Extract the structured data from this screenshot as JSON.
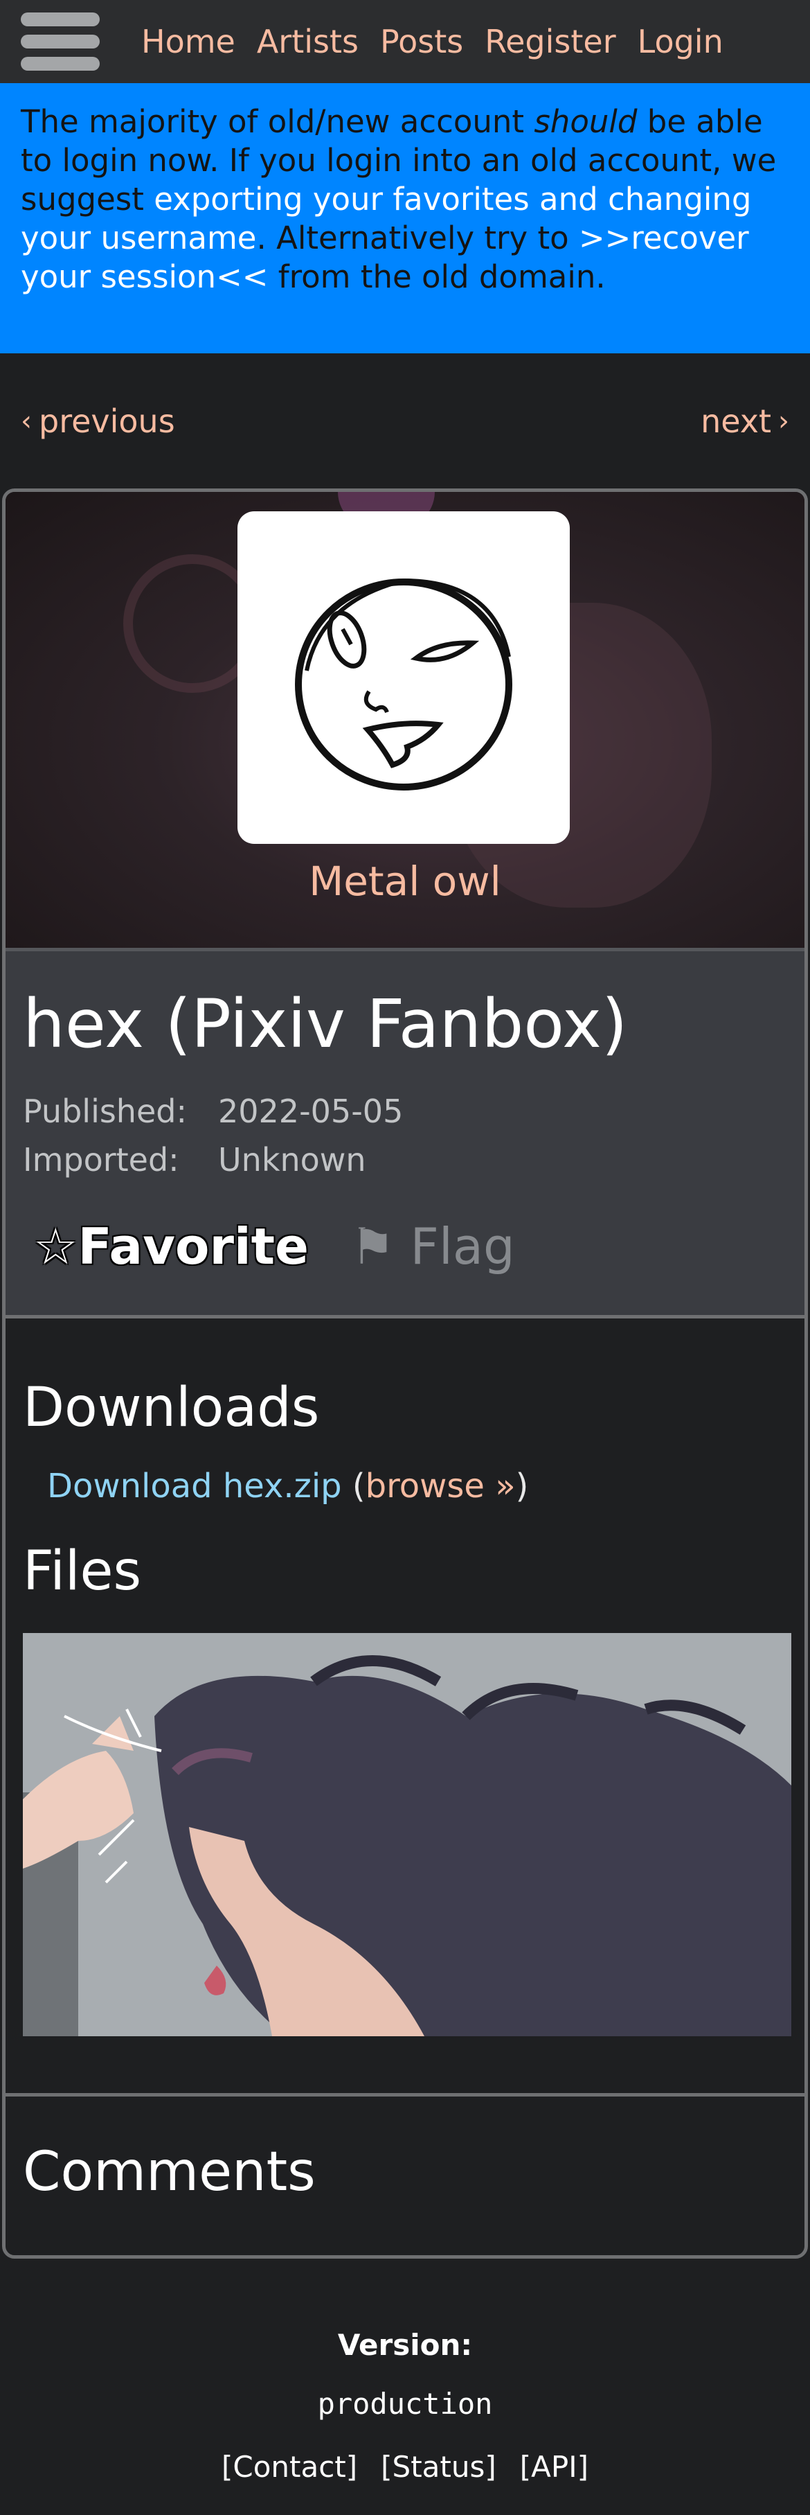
{
  "nav": {
    "menu_icon": "hamburger-menu-icon",
    "links": [
      "Home",
      "Artists",
      "Posts",
      "Register",
      "Login"
    ]
  },
  "announcement": {
    "part1": "The majority of old/new account ",
    "part2_em": "should",
    "part3": " be able to login now. If you login into an old account, we suggest ",
    "part4_link": "exporting your favorites and changing your username",
    "part5": ". Alternatively try to ",
    "part6_link": ">>recover your session<<",
    "part7": " from the old domain."
  },
  "pager": {
    "previous": "previous",
    "next": "next"
  },
  "artist": {
    "name": "Metal owl"
  },
  "post": {
    "title": "hex (Pixiv Fanbox)",
    "published_label": "Published:",
    "published_value": "2022-05-05",
    "imported_label": "Imported:",
    "imported_value": "Unknown",
    "favorite_icon": "☆",
    "favorite_label": "Favorite",
    "flag_icon": "⚑",
    "flag_label": "Flag"
  },
  "downloads": {
    "heading": "Downloads",
    "link_label": "Download hex.zip",
    "open_paren": "(",
    "browse_label": "browse »",
    "close_paren": ")"
  },
  "files": {
    "heading": "Files"
  },
  "comments": {
    "heading": "Comments"
  },
  "footer": {
    "version_label": "Version:",
    "version_value": "production",
    "links": [
      "[Contact]",
      "[Status]",
      "[API]"
    ]
  },
  "colors": {
    "accent_link": "#f7bba1",
    "download_link": "#8fd3f4",
    "announce_bg": "#0085ff",
    "page_bg": "#1e1f21"
  }
}
